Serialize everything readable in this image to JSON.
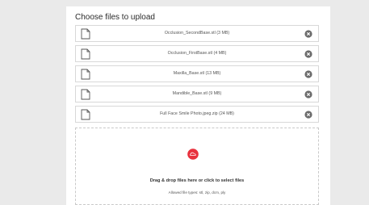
{
  "title": "Choose files to upload",
  "files": [
    {
      "label": "Occlusion_SecondBase.stl (3 MB)"
    },
    {
      "label": "Occlusion_FirstBase.stl (4 MB)"
    },
    {
      "label": "Maxilla_Base.stl (13 MB)"
    },
    {
      "label": "Mandible_Base.stl (9 MB)"
    },
    {
      "label": "Full Face Smile Photo.jpeg.zip (24 MB)"
    }
  ],
  "dropzone": {
    "primary_text": "Drag & drop files here or click to select files",
    "allowed_text": "Allowed file types: stl, zip, dcm, ply"
  },
  "icons": {
    "file": "file-outline-icon",
    "remove": "close-circle-icon",
    "upload": "upload-cloud-icon"
  },
  "colors": {
    "accent": "#e8313d",
    "remove": "#6b6b6b",
    "border": "#d8d8d8",
    "background": "#eaeaea"
  }
}
